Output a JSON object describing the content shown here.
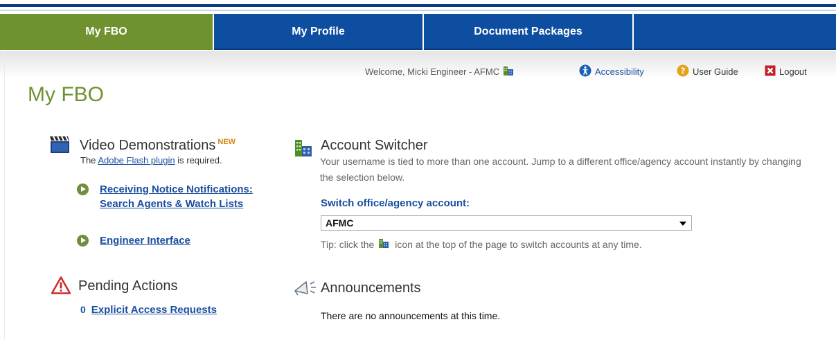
{
  "nav": {
    "tabs": [
      {
        "label": "My FBO",
        "active": true
      },
      {
        "label": "My Profile",
        "active": false
      },
      {
        "label": "Document Packages",
        "active": false
      },
      {
        "label": "",
        "active": false
      }
    ]
  },
  "utility": {
    "welcome": "Welcome, Micki Engineer - AFMC",
    "accessibility": "Accessibility",
    "user_guide": "User Guide",
    "logout": "Logout"
  },
  "page": {
    "title": "My FBO"
  },
  "video": {
    "title": "Video Demonstrations",
    "new_badge": "NEW",
    "note_prefix": "The",
    "note_link": "Adobe Flash plugin",
    "note_suffix": "is required.",
    "items": [
      {
        "label": "Receiving Notice Notifications: Search Agents & Watch Lists"
      },
      {
        "label": "Engineer Interface"
      }
    ]
  },
  "pending": {
    "title": "Pending Actions",
    "count": "0",
    "link": "Explicit Access Requests"
  },
  "account_switcher": {
    "title": "Account Switcher",
    "description": "Your username is tied to more than one account. Jump to a different office/agency account instantly by changing the selection below.",
    "field_label": "Switch office/agency account:",
    "selected": "AFMC",
    "tip_prefix": "Tip: click the",
    "tip_suffix": "icon at the top of the page to switch accounts at any time."
  },
  "announcements": {
    "title": "Announcements",
    "message": "There are no announcements at this time."
  },
  "colors": {
    "brand_blue": "#0d4ea0",
    "brand_green": "#6f9130",
    "link_blue": "#1a4fa0"
  }
}
